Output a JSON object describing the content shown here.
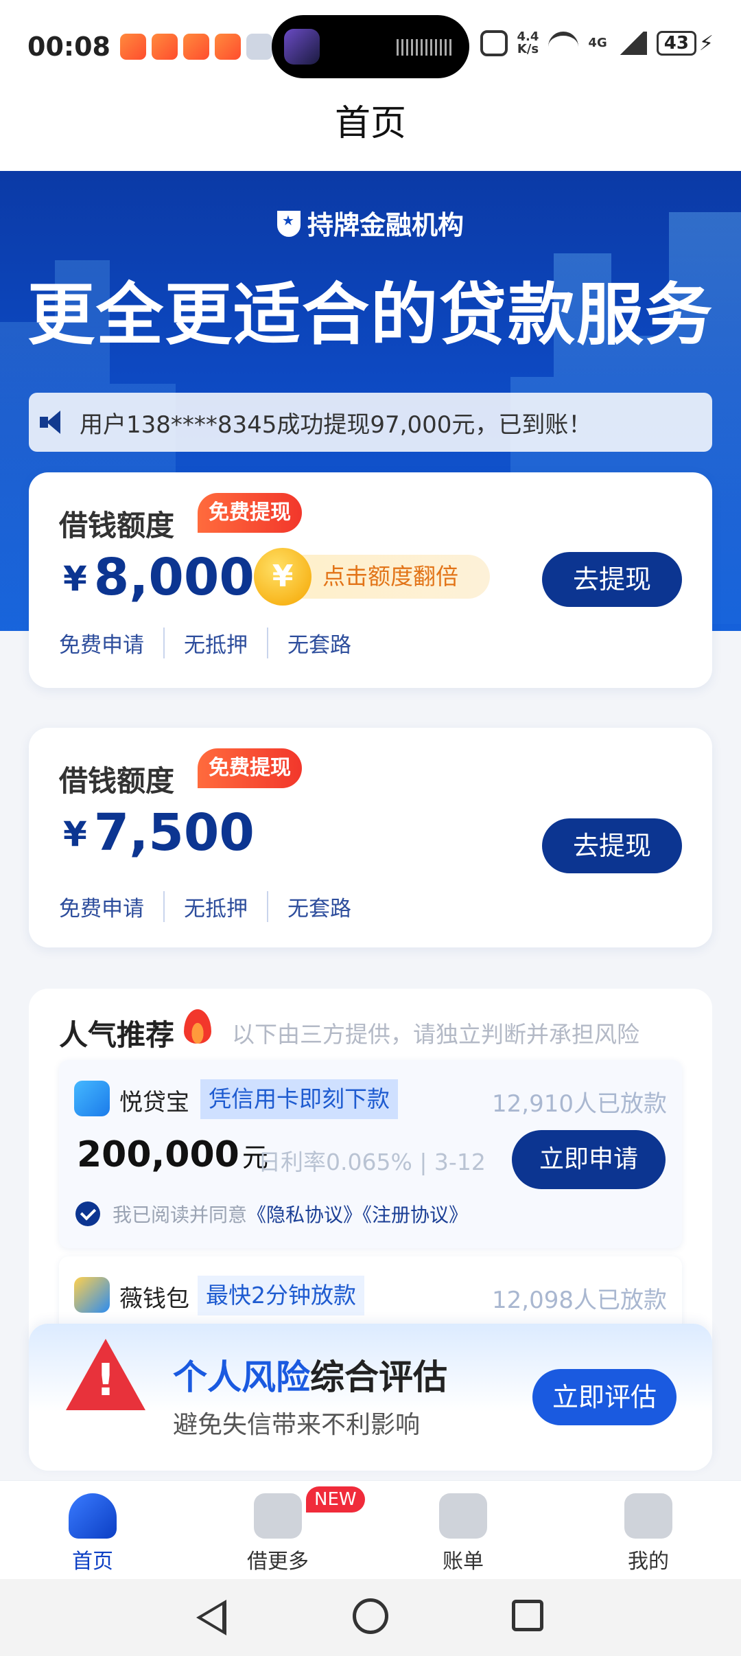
{
  "status_bar": {
    "time": "00:08",
    "net_speed_value": "4.4",
    "net_speed_unit": "K/s",
    "network_type": "4G",
    "battery": "43"
  },
  "header": {
    "title": "首页"
  },
  "banner": {
    "license_text": "持牌金融机构",
    "headline": "更全更适合的贷款服务",
    "ticker": "用户138****8345成功提现97,000元，已到账！"
  },
  "quota_cards": [
    {
      "label": "借钱额度",
      "badge": "免费提现",
      "currency": "¥",
      "amount": "8,000",
      "promo": "点击额度翻倍",
      "button": "去提现",
      "tags": [
        "免费申请",
        "无抵押",
        "无套路"
      ]
    },
    {
      "label": "借钱额度",
      "badge": "免费提现",
      "currency": "¥",
      "amount": "7,500",
      "button": "去提现",
      "tags": [
        "免费申请",
        "无抵押",
        "无套路"
      ]
    }
  ],
  "recommend": {
    "title": "人气推荐",
    "note": "以下由三方提供，请独立判断并承担风险",
    "products": [
      {
        "name": "悦贷宝",
        "tag": "凭信用卡即刻下款",
        "count": "12,910人已放款",
        "amount": "200,000",
        "unit": "元",
        "rate": "日利率0.065%  |  3-12",
        "button": "立即申请",
        "agree_prefix": "我已阅读并同意",
        "agree_links": "《隐私协议》《注册协议》"
      },
      {
        "name": "薇钱包",
        "tag": "最快2分钟放款",
        "count": "12,098人已放款"
      }
    ]
  },
  "risk": {
    "title_highlight": "个人风险",
    "title_rest": "综合评估",
    "subtitle": "避免失信带来不利影响",
    "button": "立即评估"
  },
  "bottom_nav": {
    "items": [
      {
        "label": "首页"
      },
      {
        "label": "借更多",
        "badge": "NEW"
      },
      {
        "label": "账单"
      },
      {
        "label": "我的"
      }
    ]
  },
  "colors": {
    "primary": "#0c3591",
    "accent_blue": "#1a5ae0",
    "badge_red": "#f2372b",
    "promo_orange": "#e27418"
  },
  "icons": [
    "shield-icon",
    "speaker-icon",
    "coin-icon",
    "fire-icon",
    "check-icon",
    "warning-icon",
    "home-tab-icon",
    "borrow-tab-icon",
    "bill-tab-icon",
    "profile-tab-icon",
    "back-icon",
    "home-icon",
    "recent-icon"
  ]
}
